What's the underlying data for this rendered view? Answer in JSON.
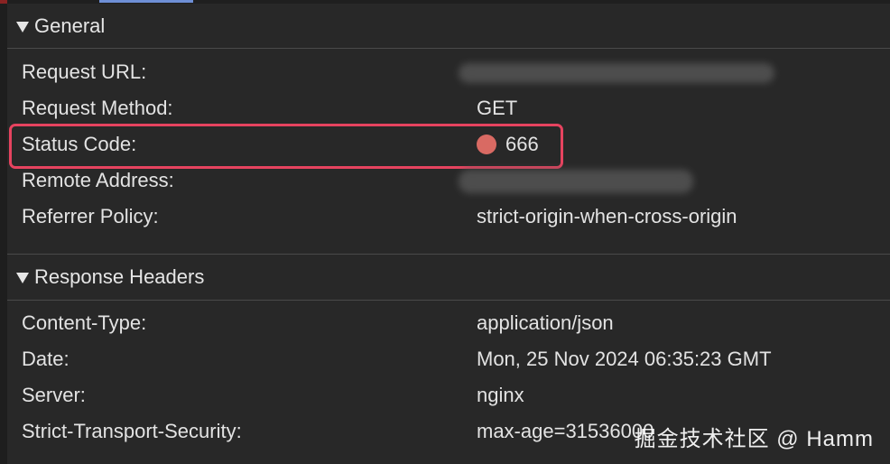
{
  "general": {
    "title": "General",
    "rows": [
      {
        "key": "Request URL:",
        "value": ""
      },
      {
        "key": "Request Method:",
        "value": "GET"
      },
      {
        "key": "Status Code:",
        "value": "666"
      },
      {
        "key": "Remote Address:",
        "value": ""
      },
      {
        "key": "Referrer Policy:",
        "value": "strict-origin-when-cross-origin"
      }
    ]
  },
  "response_headers": {
    "title": "Response Headers",
    "rows": [
      {
        "key": "Content-Type:",
        "value": "application/json"
      },
      {
        "key": "Date:",
        "value": "Mon, 25 Nov 2024 06:35:23 GMT"
      },
      {
        "key": "Server:",
        "value": "nginx"
      },
      {
        "key": "Strict-Transport-Security:",
        "value": "max-age=31536000"
      }
    ]
  },
  "watermark": "掘金技术社区 @ Hamm",
  "colors": {
    "status_dot": "#d96a63",
    "highlight_border": "#e6435f"
  }
}
